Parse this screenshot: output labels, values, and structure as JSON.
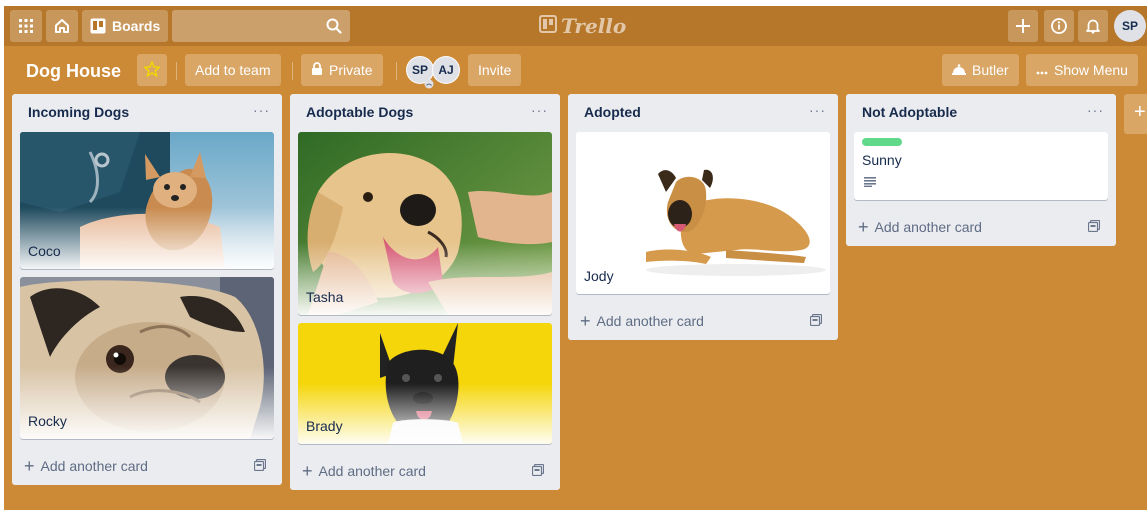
{
  "topnav": {
    "apps_icon": "grid-icon",
    "home_icon": "home-icon",
    "boards_label": "Boards",
    "search_placeholder": "",
    "logo_text": "Trello",
    "user_initials": "SP"
  },
  "board": {
    "title": "Dog House",
    "add_to_team": "Add to team",
    "visibility": "Private",
    "members": [
      "SP",
      "AJ"
    ],
    "invite": "Invite",
    "butler": "Butler",
    "show_menu": "Show Menu"
  },
  "lists": [
    {
      "title": "Incoming Dogs",
      "cards": [
        {
          "name": "Coco",
          "image": "chihuahua-with-vet-photo"
        },
        {
          "name": "Rocky",
          "image": "pug-closeup-photo"
        }
      ],
      "add_card": "Add another card"
    },
    {
      "title": "Adoptable Dogs",
      "cards": [
        {
          "name": "Tasha",
          "image": "golden-retriever-photo"
        },
        {
          "name": "Brady",
          "image": "french-bulldog-yellow-photo"
        }
      ],
      "add_card": "Add another card"
    },
    {
      "title": "Adopted",
      "cards": [
        {
          "name": "Jody",
          "image": "shepherd-mix-lying-photo"
        }
      ],
      "add_card": "Add another card"
    },
    {
      "title": "Not Adoptable",
      "cards": [
        {
          "name": "Sunny",
          "label_color": "#61d98a",
          "badge": "description-icon"
        }
      ],
      "add_card": "Add another card"
    }
  ],
  "colors": {
    "board_background": "#cd8a36",
    "nav_background": "#b6772a",
    "list_background": "#ebecf0",
    "label_green": "#61d98a",
    "star": "#f2d600"
  }
}
